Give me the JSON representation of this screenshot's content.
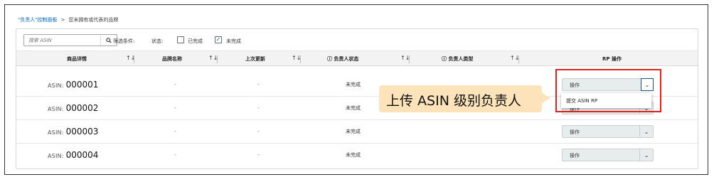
{
  "breadcrumb": {
    "link": "\"负责人\"控制面板",
    "separator": ">",
    "current": "您未拥有或代表的品牌"
  },
  "filters": {
    "search_placeholder": "搜索 ASIN",
    "search_icon": "magnifier-icon",
    "filter_label": "筛选条件:",
    "status_label": "状态:",
    "completed_label": "已完成",
    "completed_checked": false,
    "incomplete_label": "未完成",
    "incomplete_checked": true
  },
  "table": {
    "headers": [
      "商品详情",
      "品牌名称",
      "上次更新",
      "负责人状态",
      "负责人类型",
      "RP 操作"
    ],
    "sort_icon": "↑↓",
    "info_icon": "ⓘ",
    "rows": [
      {
        "asin_tag": "ASIN:",
        "asin": "000001",
        "brand": "-",
        "updated": "-",
        "status": "未完成",
        "action": "操作"
      },
      {
        "asin_tag": "ASIN:",
        "asin": "000002",
        "brand": "-",
        "updated": "-",
        "status": "未完成",
        "action": "操作"
      },
      {
        "asin_tag": "ASIN:",
        "asin": "000003",
        "brand": "-",
        "updated": "-",
        "status": "未完成",
        "action": "操作"
      },
      {
        "asin_tag": "ASIN:",
        "asin": "000004",
        "brand": "-",
        "updated": "-",
        "status": "未完成",
        "action": "操作"
      }
    ]
  },
  "dropdown": {
    "open_row": 1,
    "items": [
      "提交 ASIN RP"
    ],
    "chevron_icon": "chevron-down-icon"
  },
  "annotation": {
    "callout_text": "上传 ASIN 级别负责人",
    "highlight_color": "#e0201b",
    "callout_color": "#fce3b9"
  }
}
